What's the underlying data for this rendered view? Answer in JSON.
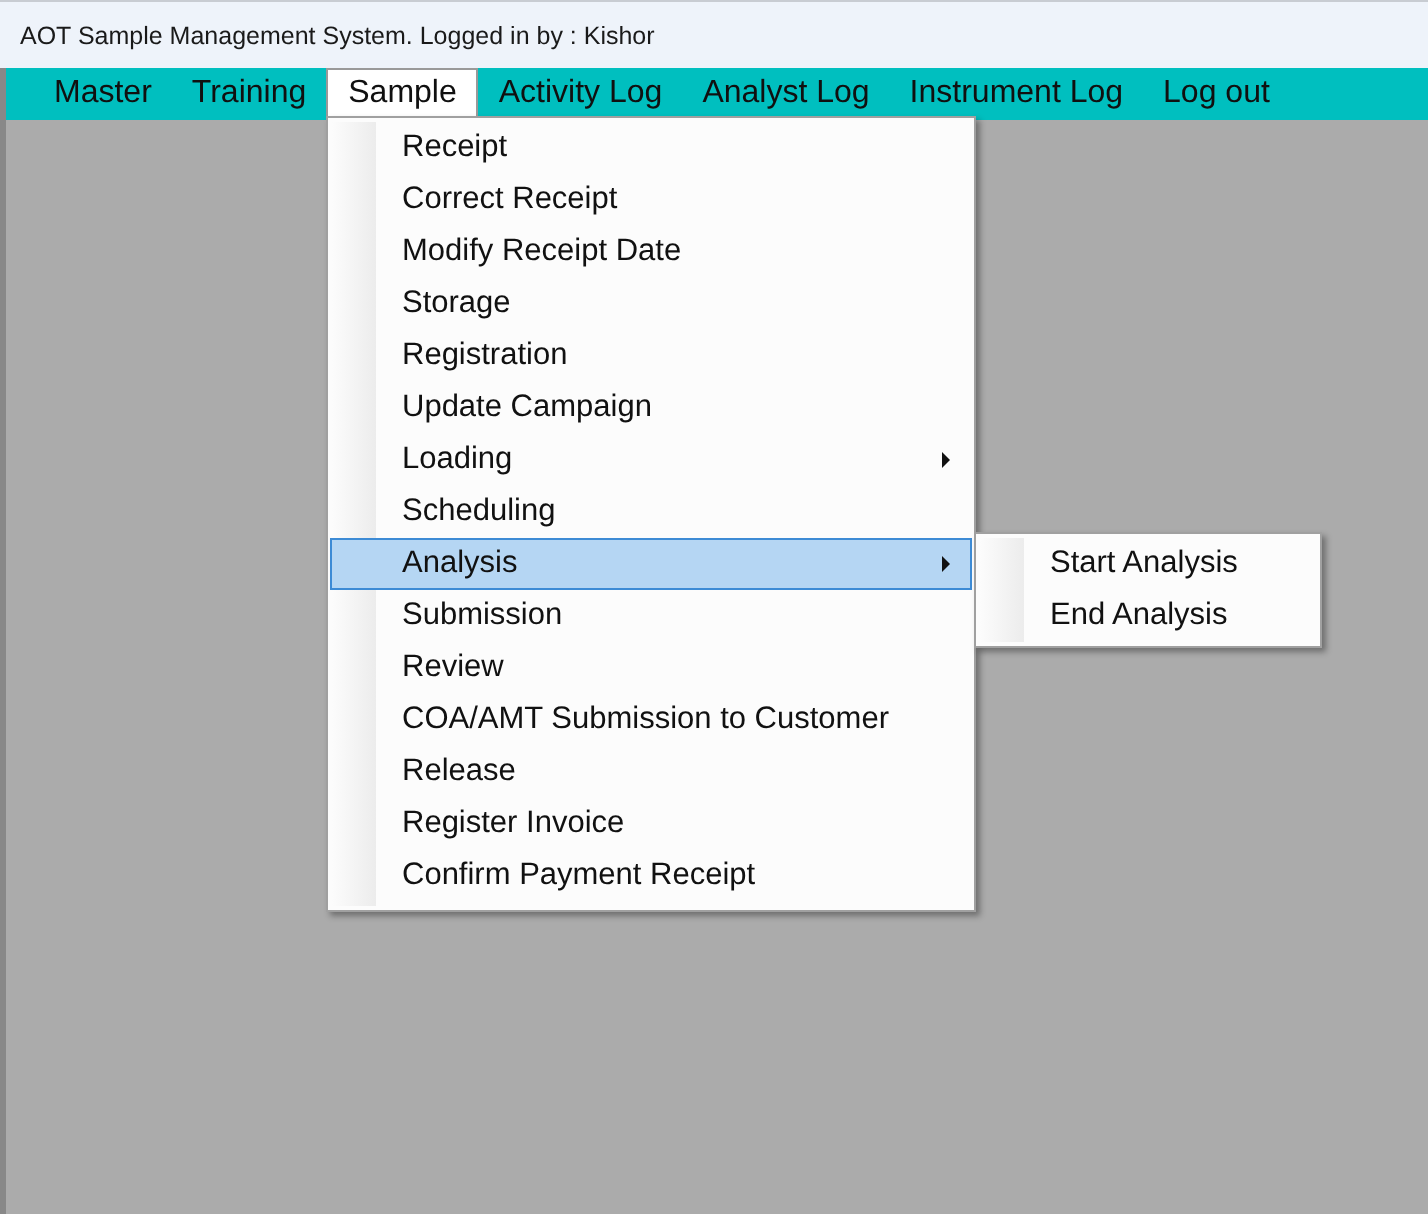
{
  "window": {
    "title": "AOT Sample Management System. Logged in by : Kishor"
  },
  "menu_bar": [
    {
      "label": "Master",
      "selected": false
    },
    {
      "label": "Training",
      "selected": false
    },
    {
      "label": "Sample",
      "selected": true
    },
    {
      "label": "Activity Log",
      "selected": false
    },
    {
      "label": "Analyst Log",
      "selected": false
    },
    {
      "label": "Instrument Log",
      "selected": false
    },
    {
      "label": "Log out",
      "selected": false
    }
  ],
  "dropdown": {
    "items": [
      {
        "label": "Receipt",
        "kind": "command",
        "selected": false
      },
      {
        "label": "Correct Receipt",
        "kind": "command",
        "selected": false
      },
      {
        "label": "Modify Receipt Date",
        "kind": "command",
        "selected": false
      },
      {
        "label": "Storage",
        "kind": "command",
        "selected": false
      },
      {
        "label": "Registration",
        "kind": "command",
        "selected": false
      },
      {
        "label": "Update Campaign",
        "kind": "command",
        "selected": false
      },
      {
        "label": "Loading",
        "kind": "submenu",
        "selected": false
      },
      {
        "label": "Scheduling",
        "kind": "command",
        "selected": false
      },
      {
        "label": "Analysis",
        "kind": "submenu",
        "selected": true,
        "children": [
          {
            "label": "Start Analysis",
            "selected": false
          },
          {
            "label": "End Analysis",
            "selected": false
          }
        ]
      },
      {
        "label": "Submission",
        "kind": "command",
        "selected": false
      },
      {
        "label": "Review",
        "kind": "command",
        "selected": false
      },
      {
        "label": "COA/AMT Submission to Customer",
        "kind": "command",
        "selected": false
      },
      {
        "label": "Release",
        "kind": "command",
        "selected": false
      },
      {
        "label": "Register Invoice",
        "kind": "command",
        "selected": false
      },
      {
        "label": "Confirm Payment Receipt",
        "kind": "command",
        "selected": false
      }
    ]
  }
}
